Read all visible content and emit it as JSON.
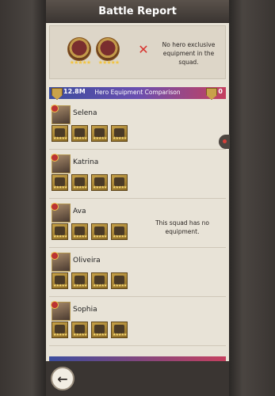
{
  "header": {
    "title": "Battle Report"
  },
  "top": {
    "no_exclusive_text": "No hero exclusive equipment in the squad."
  },
  "comparison": {
    "left_value": "12.8M",
    "title": "Hero Equipment Comparison",
    "right_value": "0"
  },
  "heroes": [
    {
      "name": "Selena"
    },
    {
      "name": "Katrina"
    },
    {
      "name": "Ava"
    },
    {
      "name": "Oliveira"
    },
    {
      "name": "Sophia"
    }
  ],
  "right_side": {
    "no_equipment_text": "This squad has no equipment."
  },
  "icons": {
    "back": "back-arrow-icon",
    "cross": "x-mark-icon",
    "shield": "shield-icon"
  },
  "colors": {
    "accent_red": "#d8342f",
    "bar_blue": "#3b4d9e",
    "bar_pink": "#c5405f"
  }
}
